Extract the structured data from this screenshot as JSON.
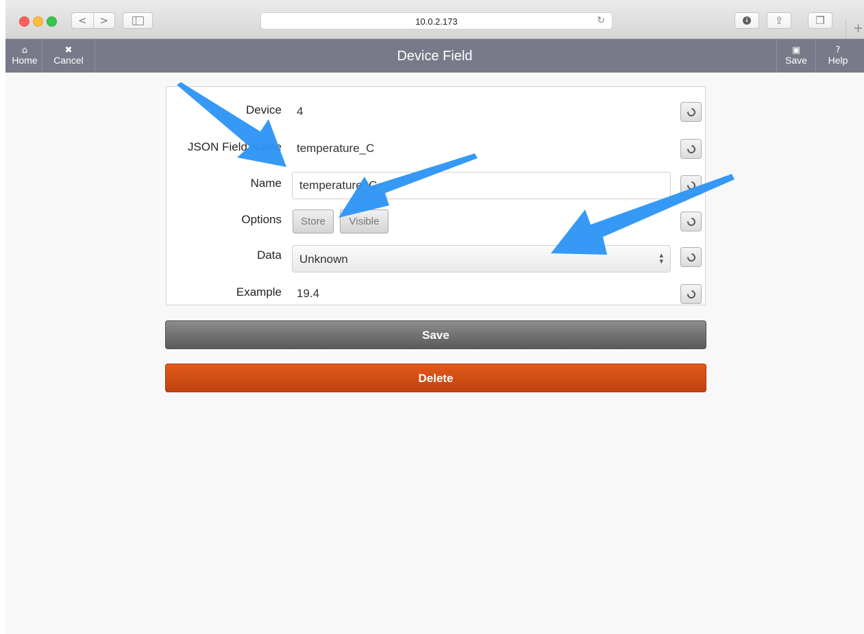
{
  "browser": {
    "url": "10.0.2.173",
    "back_glyph": "<",
    "forward_glyph": ">",
    "reload_glyph": "↻",
    "share_glyph": "⇪",
    "tabs_glyph": "❐",
    "new_tab_glyph": "+",
    "download_glyph": "↓"
  },
  "header": {
    "title": "Device Field",
    "home_label": "Home",
    "home_icon": "⌂",
    "cancel_label": "Cancel",
    "cancel_icon": "✖",
    "save_label": "Save",
    "save_icon": "▣",
    "help_label": "Help",
    "help_icon": "?",
    "bar_color": "#787a89"
  },
  "form": {
    "device": {
      "label": "Device",
      "value": "4"
    },
    "json_field": {
      "label": "JSON Field Name",
      "value": "temperature_C"
    },
    "name": {
      "label": "Name",
      "value": "temperature_C"
    },
    "options": {
      "label": "Options",
      "store_label": "Store",
      "visible_label": "Visible"
    },
    "data": {
      "label": "Data",
      "value": "Unknown",
      "arrow_glyph": "▲▼"
    },
    "example": {
      "label": "Example",
      "value": "19.4"
    }
  },
  "actions": {
    "save_label": "Save",
    "delete_label": "Delete",
    "delete_color": "#d24b14"
  },
  "annotation_color": "#2b93f5"
}
